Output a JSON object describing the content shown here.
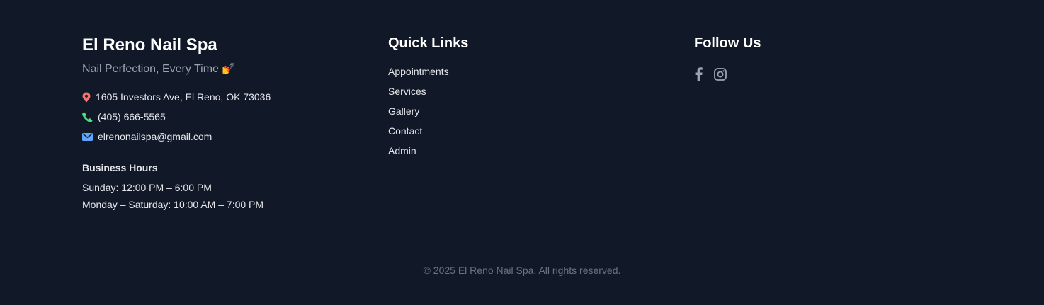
{
  "brand": {
    "title": "El Reno Nail Spa",
    "tagline": "Nail Perfection, Every Time",
    "tagline_emoji": "💅"
  },
  "contact": {
    "address": "1605 Investors Ave, El Reno, OK 73036",
    "phone": "(405) 666-5565",
    "email": "elrenonailspa@gmail.com",
    "icons": {
      "address": "map-pin-icon",
      "phone": "phone-icon",
      "email": "envelope-icon"
    },
    "icon_colors": {
      "address": "#f87171",
      "phone": "#4ade80",
      "email": "#60a5fa"
    }
  },
  "hours": {
    "title": "Business Hours",
    "lines": [
      "Sunday: 12:00 PM – 6:00 PM",
      "Monday – Saturday: 10:00 AM – 7:00 PM"
    ]
  },
  "quick_links": {
    "heading": "Quick Links",
    "items": [
      {
        "label": "Appointments"
      },
      {
        "label": "Services"
      },
      {
        "label": "Gallery"
      },
      {
        "label": "Contact"
      },
      {
        "label": "Admin"
      }
    ]
  },
  "social": {
    "heading": "Follow Us",
    "icons": [
      "facebook-icon",
      "instagram-icon"
    ],
    "icon_color": "#9ca3af"
  },
  "footer": {
    "copyright": "© 2025 El Reno Nail Spa. All rights reserved."
  },
  "colors": {
    "background": "#111827",
    "heading": "#ffffff",
    "text": "#e5e7eb",
    "muted": "#9ca3af",
    "copyright": "#6b7280",
    "divider": "#1f2937"
  }
}
